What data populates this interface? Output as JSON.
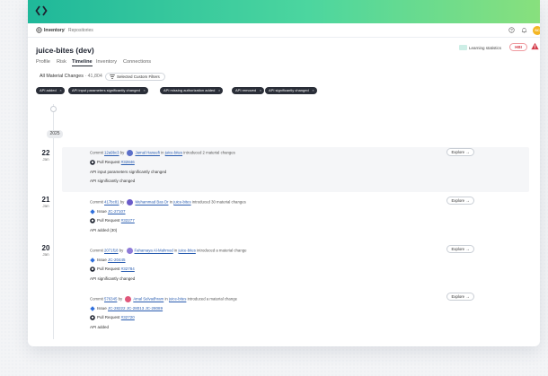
{
  "topbar": {
    "crumb_root": "Inventory",
    "crumb_sep": "/",
    "crumb_current": "Repositories",
    "avatar_initials": "SC"
  },
  "page": {
    "title": "juice-bites (dev)",
    "tabs": [
      "Profile",
      "Risk",
      "Timeline",
      "Inventory",
      "Connections"
    ],
    "active_tab": "Timeline",
    "learning_statistics": "Learning statistics",
    "hidden_badge": "HBI"
  },
  "filters": {
    "label": "All Material Changes",
    "count": "· 41,804",
    "custom_filters_button": "Selected Custom Filters",
    "chips": [
      "API added",
      "API input parameters significantly changed",
      "API missing authorization added",
      "API removed",
      "API significantly changed"
    ]
  },
  "timeline": {
    "year": "2025",
    "explore_label": "Explore →",
    "commits": [
      {
        "day": "22",
        "month": "Jan",
        "commit_prefix": "Commit",
        "commit_id": "12a9bc3",
        "by": "by",
        "author": "Jamal Haneefi",
        "in": "in",
        "repo": "juice-bites",
        "action": "introduced 2 material changes",
        "refs": [
          {
            "type": "Pull Request",
            "id": "#32846",
            "icon": "github-icon"
          }
        ],
        "changes": [
          "API input parameters significantly changed",
          "API significantly changed"
        ]
      },
      {
        "day": "21",
        "month": "Jan",
        "commit_prefix": "Commit",
        "commit_id": "417bc81",
        "by": "by",
        "author": "Muhammad Bas Dr",
        "in": "in",
        "repo": "juice-bites",
        "action": "introduced 30 material changes",
        "refs": [
          {
            "type": "Issue",
            "id": "JC-27107",
            "icon": "jira-icon"
          },
          {
            "type": "Pull Request",
            "id": "#32277",
            "icon": "github-icon"
          }
        ],
        "changes": [
          "API added (30)"
        ]
      },
      {
        "day": "20",
        "month": "Jan",
        "commit_prefix": "Commit",
        "commit_id": "2071f18",
        "by": "by",
        "author": "Fahamaya Al-Mahmod",
        "in": "in",
        "repo": "juice-bites",
        "action": "introduced a material change",
        "refs": [
          {
            "type": "Issue",
            "id": "JC-20445",
            "icon": "jira-icon"
          },
          {
            "type": "Pull Request",
            "id": "#32784",
            "icon": "github-icon"
          }
        ],
        "changes": [
          "API significantly changed"
        ]
      },
      {
        "day": "",
        "month": "",
        "commit_prefix": "Commit",
        "commit_id": "576345",
        "by": "by",
        "author": "Amal Selvadhram",
        "in": "in",
        "repo": "juice-bites",
        "action": "introduced a material change",
        "refs": [
          {
            "type": "Issue",
            "id": "JC-28222 JC-28013 JC-28089",
            "icon": "jira-icon"
          },
          {
            "type": "Pull Request",
            "id": "#32720",
            "icon": "github-icon"
          }
        ],
        "changes": [
          "API added"
        ]
      }
    ]
  },
  "colors": {
    "hero_start": "#1fb89a",
    "hero_end": "#88e07d",
    "link": "#2a5db0",
    "danger": "#d43d4b",
    "avatar": "#f4b623",
    "chip_bg": "#2a2e38"
  }
}
